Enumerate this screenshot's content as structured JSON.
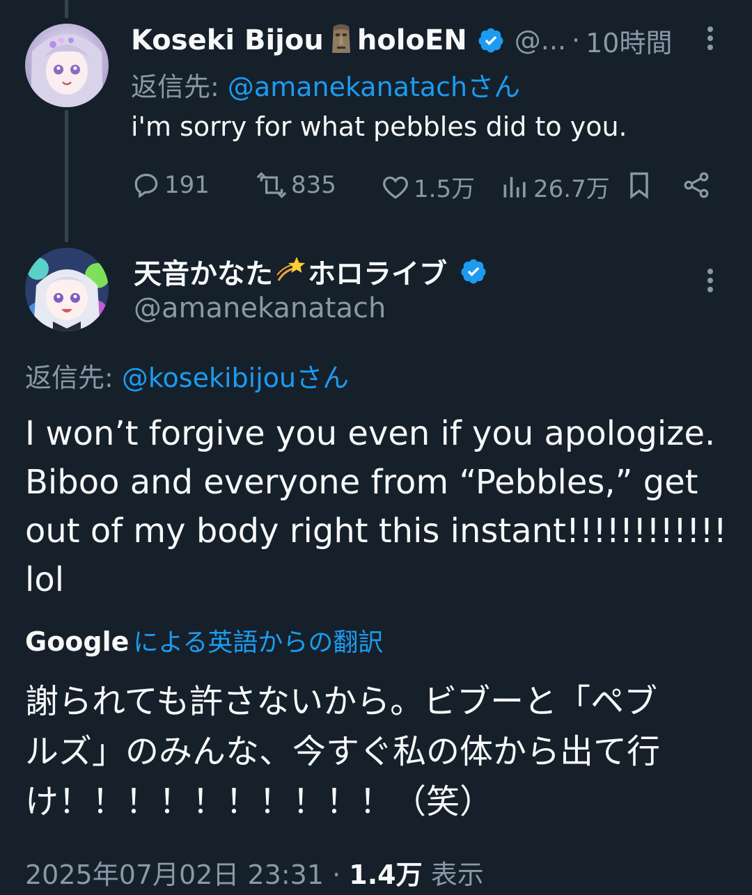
{
  "colors": {
    "background": "#15202b",
    "text": "#f7f9f9",
    "muted": "#8b98a5",
    "accent": "#1d9bf0",
    "thread_line": "#38444d"
  },
  "parent_tweet": {
    "display_name": "Koseki Bijou",
    "name_suffix": "holoEN",
    "emoji_icon": "moai-icon",
    "handle": "@...",
    "separator": "·",
    "time": "10時間",
    "reply_prefix": "返信先:",
    "reply_to": "@amanekanatachさん",
    "text": "i'm sorry for what pebbles did to you.",
    "stats": {
      "replies": "191",
      "retweets": "835",
      "likes": "1.5万",
      "views": "26.7万"
    }
  },
  "main_tweet": {
    "display_name_a": "天音かなた",
    "emoji_icon": "dizzy-star-icon",
    "display_name_b": "ホロライブ",
    "handle": "@amanekanatach",
    "reply_prefix": "返信先:",
    "reply_to": "@kosekibijouさん",
    "text_lines": [
      "I won’t forgive you even if you apologize.",
      "Biboo and everyone from “Pebbles,” get",
      "out of my body right this instant!!!!!!!!!!!!",
      "lol"
    ],
    "translation_brand": "Google",
    "translation_label": "による英語からの翻訳",
    "translated_lines": [
      "謝られても許さないから。ビブーと「ペブ",
      "ルズ」のみんな、今すぐ私の体から出て行",
      "け！！！！！！！！！！（笑）"
    ],
    "timestamp": "2025年07月02日 23:31",
    "separator": "·",
    "view_count": "1.4万",
    "view_label": "表示"
  }
}
